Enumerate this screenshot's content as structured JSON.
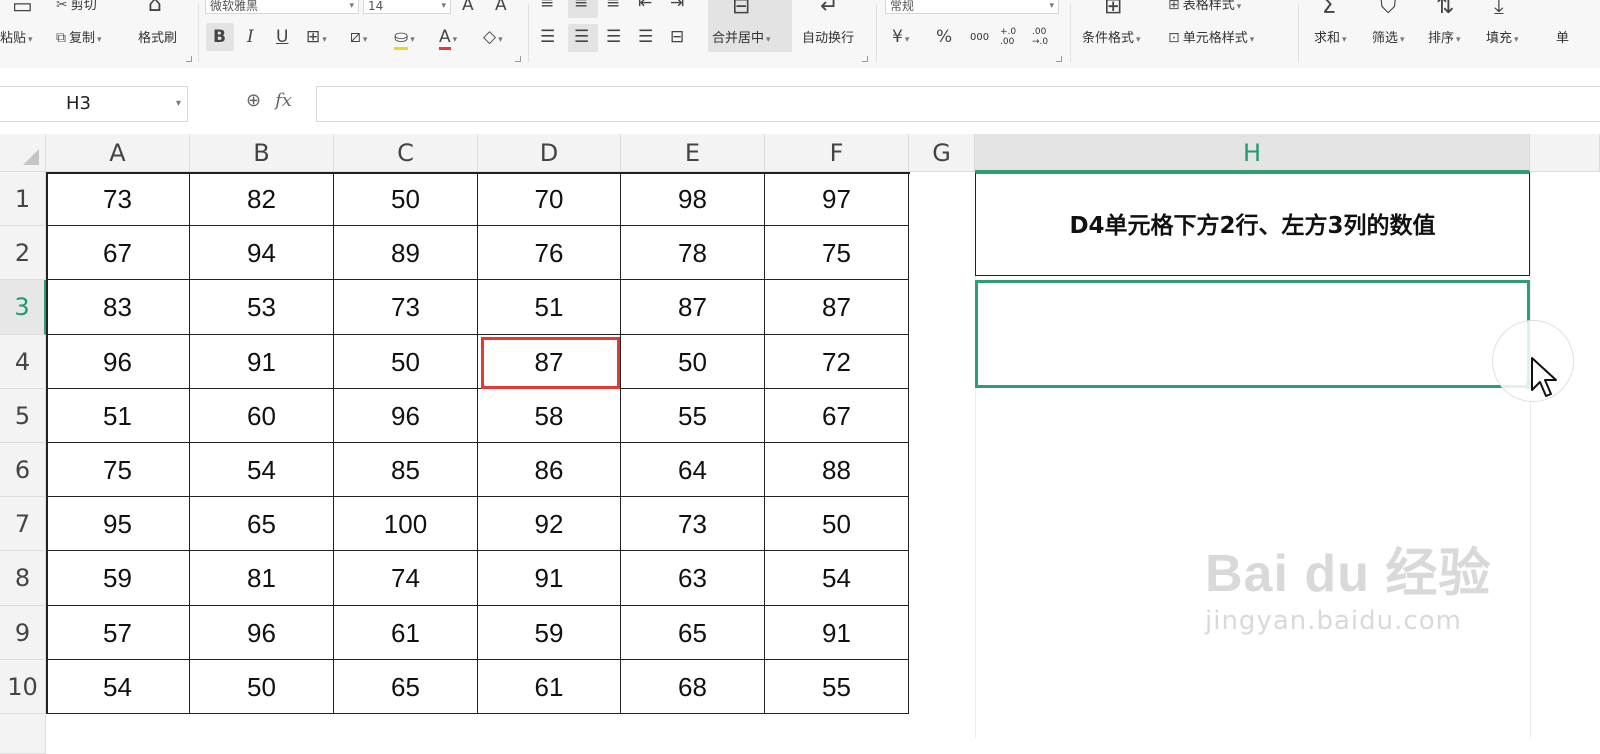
{
  "ribbon": {
    "clipboard": {
      "paste_label": "粘贴",
      "cut_label": "剪切",
      "copy_label": "复制",
      "format_painter_label": "格式刷"
    },
    "font": {
      "font_name": "微软雅黑",
      "font_size": "14",
      "bold": "B",
      "italic": "I",
      "underline": "U"
    },
    "alignment": {
      "merge_center_label": "合并居中",
      "wrap_text_label": "自动换行"
    },
    "number": {
      "format_value": "常规",
      "currency_symbol": "¥",
      "percent_symbol": "%",
      "thousands_symbol": "000",
      "inc_decimal_symbol": "+.0 .00",
      "dec_decimal_symbol": ".00 →.0"
    },
    "styles": {
      "conditional_format_label": "条件格式",
      "table_style_label": "表格样式",
      "cell_style_label": "单元格样式"
    },
    "editing": {
      "sum_label": "求和",
      "filter_label": "筛选",
      "sort_label": "排序",
      "fill_label": "填充",
      "cut_off_label": "单"
    }
  },
  "formula_bar": {
    "name_box_value": "H3",
    "fx_symbol": "fx",
    "formula_value": ""
  },
  "sheet": {
    "columns": [
      "A",
      "B",
      "C",
      "D",
      "E",
      "F",
      "G",
      "H"
    ],
    "selected_column": "H",
    "selected_row": 3,
    "rows": [
      {
        "num": "1",
        "values": [
          "73",
          "82",
          "50",
          "70",
          "98",
          "97"
        ]
      },
      {
        "num": "2",
        "values": [
          "67",
          "94",
          "89",
          "76",
          "78",
          "75"
        ]
      },
      {
        "num": "3",
        "values": [
          "83",
          "53",
          "73",
          "51",
          "87",
          "87"
        ]
      },
      {
        "num": "4",
        "values": [
          "96",
          "91",
          "50",
          "87",
          "50",
          "72"
        ]
      },
      {
        "num": "5",
        "values": [
          "51",
          "60",
          "96",
          "58",
          "55",
          "67"
        ]
      },
      {
        "num": "6",
        "values": [
          "75",
          "54",
          "85",
          "86",
          "64",
          "88"
        ]
      },
      {
        "num": "7",
        "values": [
          "95",
          "65",
          "100",
          "92",
          "73",
          "50"
        ]
      },
      {
        "num": "8",
        "values": [
          "59",
          "81",
          "74",
          "91",
          "63",
          "54"
        ]
      },
      {
        "num": "9",
        "values": [
          "57",
          "96",
          "61",
          "59",
          "65",
          "91"
        ]
      },
      {
        "num": "10",
        "values": [
          "54",
          "50",
          "65",
          "61",
          "68",
          "55"
        ]
      }
    ],
    "highlighted_cell": "D4",
    "h_header_text": "D4单元格下方2行、左方3列的数值",
    "h3_value": ""
  },
  "colors": {
    "accent_green": "#2e9e72",
    "highlight_red": "#e53935"
  },
  "watermark": {
    "line1": "Bai du 经验",
    "line2": "jingyan.baidu.com"
  }
}
